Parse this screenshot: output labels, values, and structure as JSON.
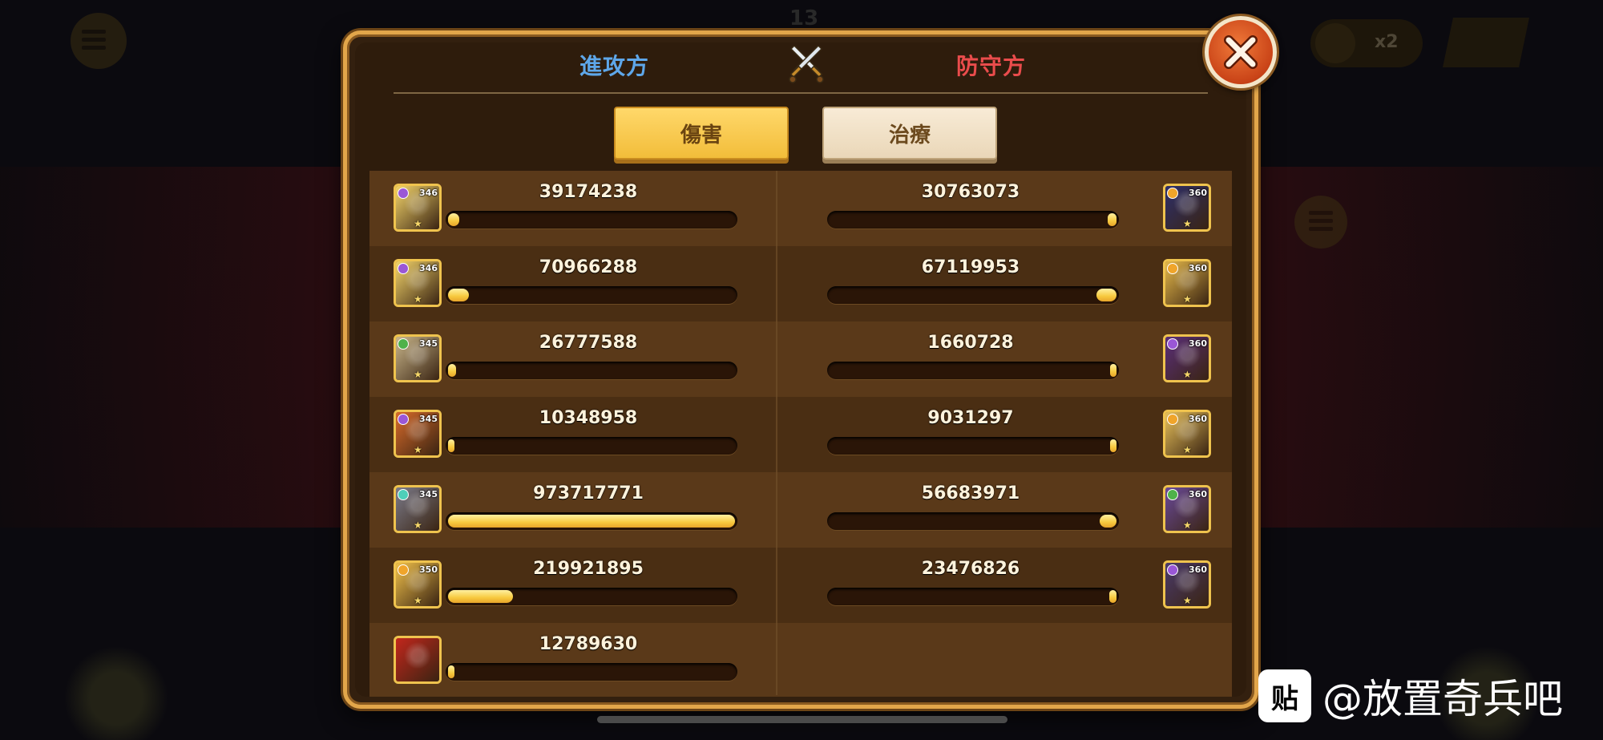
{
  "header": {
    "attacker_label": "進攻方",
    "defender_label": "防守方",
    "crossed_swords_icon": "crossed-swords-icon"
  },
  "tabs": [
    {
      "label": "傷害",
      "active": true
    },
    {
      "label": "治療",
      "active": false
    }
  ],
  "colors": {
    "attacker": "#5ea7ea",
    "defender": "#ea4c4c",
    "bar_fill": "#f7c93e",
    "panel_border": "#e2a64a"
  },
  "attackers": [
    {
      "value": "39174238",
      "level": "346",
      "fill": 0.04,
      "portrait_color": "#f3d46a",
      "badge_color": "#9a57d6"
    },
    {
      "value": "70966288",
      "level": "346",
      "fill": 0.073,
      "portrait_color": "#f3d46a",
      "badge_color": "#9a57d6"
    },
    {
      "value": "26777588",
      "level": "345",
      "fill": 0.028,
      "portrait_color": "#c9b68b",
      "badge_color": "#4fb24a"
    },
    {
      "value": "10348958",
      "level": "345",
      "fill": 0.011,
      "portrait_color": "#d76a2a",
      "badge_color": "#9a57d6"
    },
    {
      "value": "973717771",
      "level": "345",
      "fill": 1.0,
      "portrait_color": "#7b7b8a",
      "badge_color": "#4ecfb9"
    },
    {
      "value": "219921895",
      "level": "350",
      "fill": 0.226,
      "portrait_color": "#f0c04a",
      "badge_color": "#f0a52a"
    },
    {
      "value": "12789630",
      "level": "",
      "fill": 0.013,
      "portrait_color": "#c2261c",
      "badge_color": ""
    }
  ],
  "defenders": [
    {
      "value": "30763073",
      "level": "360",
      "fill": 0.032,
      "portrait_color": "#2d2f6a",
      "badge_color": "#f0a52a"
    },
    {
      "value": "67119953",
      "level": "360",
      "fill": 0.069,
      "portrait_color": "#e5b84a",
      "badge_color": "#f0a52a"
    },
    {
      "value": "1660728",
      "level": "360",
      "fill": 0.002,
      "portrait_color": "#5a2f7a",
      "badge_color": "#9a57d6"
    },
    {
      "value": "9031297",
      "level": "360",
      "fill": 0.009,
      "portrait_color": "#e7c05a",
      "badge_color": "#f0a52a"
    },
    {
      "value": "56683971",
      "level": "360",
      "fill": 0.058,
      "portrait_color": "#6a4a9a",
      "badge_color": "#4fb24a"
    },
    {
      "value": "23476826",
      "level": "360",
      "fill": 0.024,
      "portrait_color": "#4a3a6a",
      "badge_color": "#9a57d6"
    }
  ],
  "close_button_icon": "close-icon",
  "background": {
    "speed_label": "x2",
    "turn_counter": "13"
  },
  "watermark": {
    "logo_text": "贴",
    "text": "@放置奇兵吧"
  }
}
